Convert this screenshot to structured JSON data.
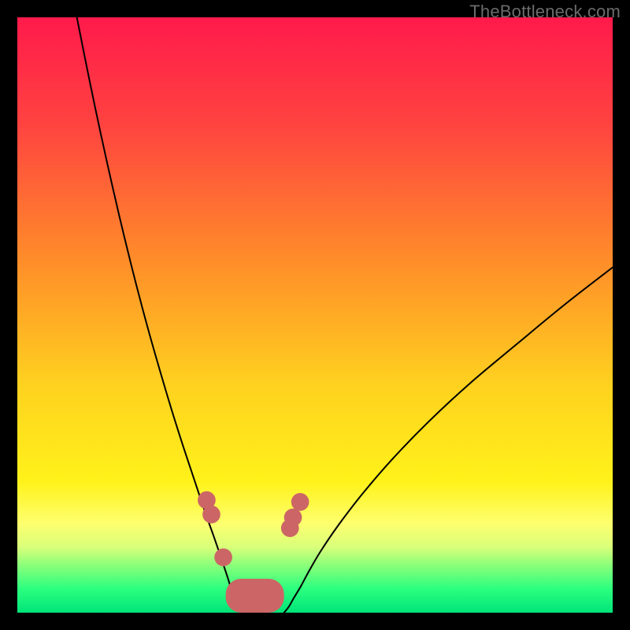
{
  "watermark": "TheBottleneck.com",
  "chart_data": {
    "type": "line",
    "title": "",
    "xlabel": "",
    "ylabel": "",
    "xlim": [
      0,
      100
    ],
    "ylim": [
      0,
      100
    ],
    "grid": false,
    "legend": false,
    "gradient_stops": [
      {
        "pct": 0,
        "color": "#ff1a4b"
      },
      {
        "pct": 18,
        "color": "#ff4340"
      },
      {
        "pct": 40,
        "color": "#ff8a2a"
      },
      {
        "pct": 62,
        "color": "#ffd21f"
      },
      {
        "pct": 78,
        "color": "#fff21a"
      },
      {
        "pct": 85,
        "color": "#fdff6e"
      },
      {
        "pct": 89,
        "color": "#d9ff7a"
      },
      {
        "pct": 92,
        "color": "#8bff7a"
      },
      {
        "pct": 96,
        "color": "#2bff7e"
      },
      {
        "pct": 100,
        "color": "#00e47a"
      }
    ],
    "series": [
      {
        "name": "left-curve",
        "stroke": "#000000",
        "x": [
          10.0,
          12.0,
          14.0,
          16.0,
          18.0,
          20.0,
          22.0,
          24.0,
          26.0,
          28.0,
          30.0,
          31.5,
          33.0,
          34.2,
          35.2,
          36.0,
          36.8,
          37.4,
          38.0
        ],
        "y": [
          100.0,
          90.0,
          80.5,
          71.5,
          63.0,
          55.0,
          47.5,
          40.5,
          33.8,
          27.5,
          21.5,
          17.0,
          12.8,
          9.3,
          6.3,
          3.8,
          1.8,
          0.6,
          0.0
        ]
      },
      {
        "name": "right-curve",
        "stroke": "#000000",
        "x": [
          44.8,
          45.6,
          46.4,
          47.6,
          49.0,
          51.0,
          54.0,
          58.0,
          63.0,
          69.0,
          76.0,
          84.0,
          92.0,
          100.0
        ],
        "y": [
          0.0,
          1.0,
          2.4,
          4.4,
          7.0,
          10.4,
          14.8,
          20.0,
          25.8,
          32.0,
          38.5,
          45.2,
          51.8,
          58.0
        ]
      }
    ],
    "markers": {
      "name": "bottom-dots",
      "fill": "#cc6666",
      "radius_pct": 1.5,
      "points": [
        {
          "x": 31.8,
          "y": 18.9
        },
        {
          "x": 32.6,
          "y": 16.5
        },
        {
          "x": 34.6,
          "y": 9.3
        },
        {
          "x": 45.8,
          "y": 14.2
        },
        {
          "x": 46.3,
          "y": 16.0
        },
        {
          "x": 47.5,
          "y": 18.6
        }
      ]
    },
    "blob": {
      "name": "bottom-blob",
      "fill": "#cc6666",
      "x_range": [
        35.0,
        44.8
      ],
      "y_range": [
        0.0,
        5.7
      ],
      "corner_radius_pct": 2.6
    }
  }
}
